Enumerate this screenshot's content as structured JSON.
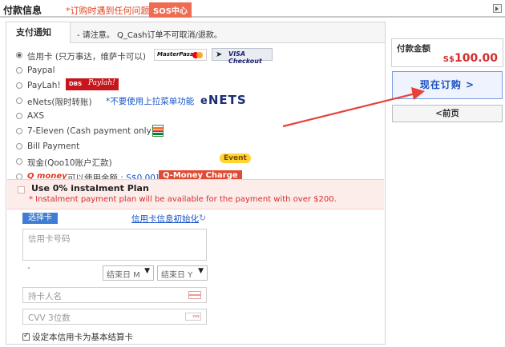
{
  "header": {
    "title": "付款信息",
    "notice": "*订购时遇到任何问题请联系",
    "sos": "SOS中心"
  },
  "tab": {
    "label": "支付通知",
    "text": "- 请注意。 Q_Cash订单不可取消/退款。"
  },
  "methods": {
    "credit_card": {
      "label": "信用卡 (只万事达，维萨卡可以)",
      "mastercard": "MasterPass",
      "visa": "VISA Checkout"
    },
    "paypal": {
      "label": "Paypal"
    },
    "paylah": {
      "label": "PayLah!",
      "logo_a": "DBS",
      "logo_b": "Paylah!"
    },
    "enets": {
      "label": "eNets(限时转账)",
      "note": "*不要使用上拉菜单功能",
      "logo": "NETS"
    },
    "axs": {
      "label": "AXS"
    },
    "seven": {
      "label": "7-Eleven (Cash payment only)"
    },
    "bill": {
      "label": "Bill Payment"
    },
    "cash": {
      "label": "现金(Qoo10账户汇款)",
      "event": "Event"
    },
    "qmoney": {
      "logo": "Q money",
      "text": "可以使用金额 : ",
      "amount": "S$0.00]",
      "charge": "Q-Money Charge"
    }
  },
  "instalment": {
    "title": "Use 0% instalment Plan",
    "note": "* Instalment payment plan will be available for the payment with over $200."
  },
  "card_form": {
    "select_card": "选择卡",
    "reset": "信用卡信息初始化",
    "card_number_placeholder": "信用卡号码",
    "month_placeholder": "结束日 M",
    "year_placeholder": "结束日 Y",
    "holder_placeholder": "持卡人名",
    "cvv_placeholder": "CVV 3位数",
    "cvv_icon": "cvv",
    "default_label": "设定本信用卡为基本结算卡"
  },
  "summary": {
    "amount_label": "付款金额",
    "currency": "S$",
    "amount": "100.00",
    "order_button": "现在订购 >",
    "prev_button": "<前页"
  },
  "colors": {
    "accent": "#1c51c2",
    "warning": "#d32f2f",
    "annotation_arrow": "#e8413a"
  }
}
